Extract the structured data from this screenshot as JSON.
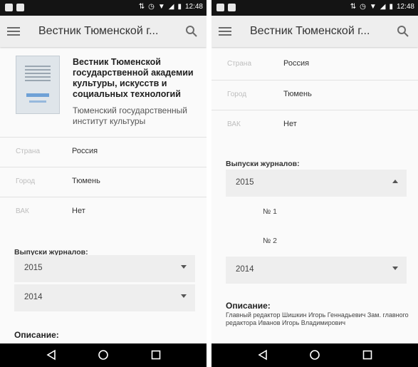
{
  "status_bar": {
    "time_left": "12:48",
    "time_right": "12:48",
    "icons": [
      "sim-icon",
      "screenshot-icon",
      "data-transfer-icon",
      "alarm-icon",
      "wifi-icon",
      "signal-icon",
      "battery-icon"
    ]
  },
  "app_bar": {
    "title": "Вестник Тюменской г...",
    "icons": [
      "menu-icon",
      "search-icon"
    ]
  },
  "journal": {
    "name": "Вестник Тюменской государственной академии культуры, искусств и социальных технологий",
    "institution": "Тюменский государственный институт культуры"
  },
  "meta": {
    "country_label": "Страна",
    "country_value": "Россия",
    "city_label": "Город",
    "city_value": "Тюмень",
    "vak_label": "ВАК",
    "vak_value": "Нет"
  },
  "issues": {
    "heading": "Выпуски журналов:",
    "years": [
      {
        "label": "2015",
        "expanded_in_right": true,
        "items": [
          "№ 1",
          "№ 2"
        ]
      },
      {
        "label": "2014",
        "expanded_in_right": false,
        "items": []
      }
    ]
  },
  "description": {
    "heading": "Описание:",
    "text": "Главный редактор Шишкин Игорь Геннадьевич Зам. главного редактора Иванов Игорь Владимирович"
  },
  "nav": {
    "icons": [
      "back-icon",
      "home-icon",
      "recents-icon"
    ]
  },
  "colors": {
    "app_bar": "#eeeeee",
    "status_bar": "#141414",
    "nav_bar": "#000000",
    "row_bg": "#eeeeee"
  }
}
